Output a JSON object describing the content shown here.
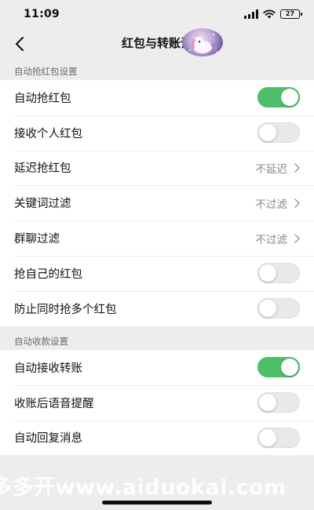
{
  "status_bar": {
    "time": "11:09",
    "battery": "27",
    "icons": [
      "signal-icon",
      "wifi-icon",
      "battery-icon"
    ]
  },
  "nav": {
    "title": "红包与转账设",
    "back_icon": "back-arrow-icon"
  },
  "sections": [
    {
      "header": "自动抢红包设置",
      "rows": [
        {
          "label": "自动抢红包",
          "type": "toggle",
          "on": true
        },
        {
          "label": "接收个人红包",
          "type": "toggle",
          "on": false
        },
        {
          "label": "延迟抢红包",
          "type": "select",
          "value": "不延迟"
        },
        {
          "label": "关键词过滤",
          "type": "select",
          "value": "不过滤"
        },
        {
          "label": "群聊过滤",
          "type": "select",
          "value": "不过滤"
        },
        {
          "label": "抢自己的红包",
          "type": "toggle",
          "on": false
        },
        {
          "label": "防止同时抢多个红包",
          "type": "toggle",
          "on": false
        }
      ]
    },
    {
      "header": "自动收款设置",
      "rows": [
        {
          "label": "自动接收转账",
          "type": "toggle",
          "on": true
        },
        {
          "label": "收账后语音提醒",
          "type": "toggle",
          "on": false
        },
        {
          "label": "自动回复消息",
          "type": "toggle",
          "on": false
        }
      ]
    }
  ],
  "watermark": "多多开www.aiduokai.com",
  "colors": {
    "toggle_on": "#4cbf68",
    "toggle_off": "#e9e9ea",
    "page_background": "#ededed"
  }
}
